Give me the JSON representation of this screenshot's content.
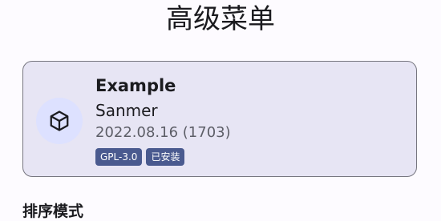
{
  "header": {
    "title": "高级菜单"
  },
  "module_card": {
    "icon": "cube-icon",
    "name": "Example",
    "author": "Sanmer",
    "version": "2022.08.16 (1703)",
    "badges": {
      "license": "GPL-3.0",
      "status": "已安装"
    }
  },
  "sections": {
    "sort_mode_label": "排序模式"
  },
  "colors": {
    "background": "#fdfbff",
    "card_background": "#e7e5f4",
    "card_border": "#777680",
    "avatar_background": "#dde1ff",
    "badge_background": "#4a5a8f",
    "badge_text": "#ffffff"
  }
}
